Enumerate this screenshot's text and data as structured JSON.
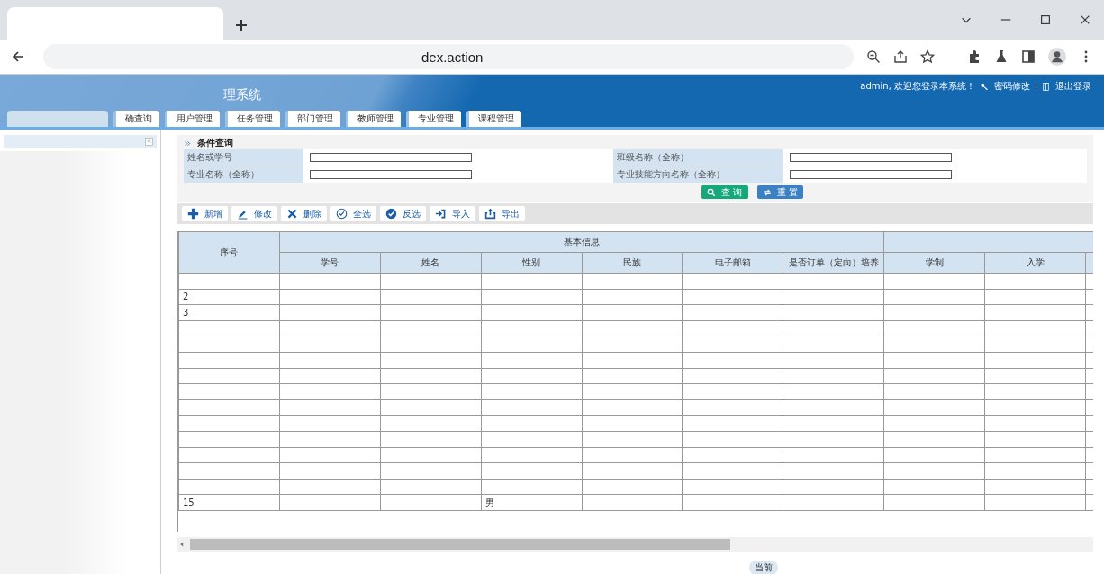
{
  "browser": {
    "address": "dex.action"
  },
  "header": {
    "title": "理系统",
    "welcome": "admin, 欢迎您登录本系统！",
    "change_password": "密码修改",
    "logout": "退出登录"
  },
  "nav_tabs": [
    {
      "label": "确查询"
    },
    {
      "label": "用户管理"
    },
    {
      "label": "任务管理"
    },
    {
      "label": "部门管理"
    },
    {
      "label": "教师管理"
    },
    {
      "label": "专业管理"
    },
    {
      "label": "课程管理"
    }
  ],
  "query": {
    "title": "条件查询",
    "fields": [
      {
        "label": "姓名或学号"
      },
      {
        "label": "班级名称（全称）"
      },
      {
        "label": "专业名称（全称）"
      },
      {
        "label": "专业技能方向名称（全称）"
      }
    ],
    "buttons": [
      {
        "label": "查 询",
        "kind": "search"
      },
      {
        "label": "重 置",
        "kind": "reset"
      }
    ]
  },
  "toolbar": [
    {
      "label": "新增",
      "kind": "add"
    },
    {
      "label": "修改",
      "kind": "edit"
    },
    {
      "label": "删除",
      "kind": "delete"
    },
    {
      "label": "全选",
      "kind": "check-all"
    },
    {
      "label": "反选",
      "kind": "invert"
    },
    {
      "label": "导入",
      "kind": "import"
    },
    {
      "label": "导出",
      "kind": "export"
    }
  ],
  "table": {
    "seq_header": "序号",
    "groups": [
      "基本信息"
    ],
    "columns": [
      "学号",
      "姓名",
      "性别",
      "民族",
      "电子邮箱",
      "是否订单（定向）培养",
      "学制",
      "入学"
    ],
    "rows": [
      {},
      {
        "seq": "2"
      },
      {
        "seq": "3"
      },
      {},
      {},
      {},
      {},
      {},
      {},
      {},
      {},
      {},
      {},
      {},
      {
        "seq": "15",
        "gender": "男"
      }
    ]
  },
  "status": {
    "text": "当前"
  }
}
